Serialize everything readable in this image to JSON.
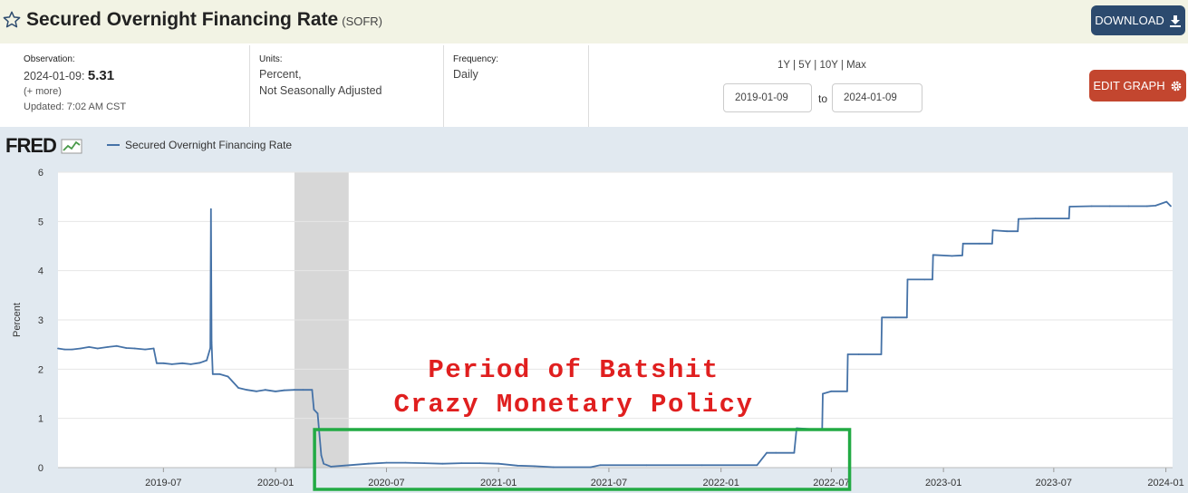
{
  "header": {
    "title": "Secured Overnight Financing Rate",
    "series_code": "(SOFR)",
    "download_label": "DOWNLOAD",
    "edit_label": "EDIT GRAPH"
  },
  "meta": {
    "observation_label": "Observation:",
    "observation_date": "2024-01-09:",
    "observation_value": "5.31",
    "more": "(+ more)",
    "updated": "Updated: 7:02 AM CST",
    "units_label": "Units:",
    "units_line1": "Percent,",
    "units_line2": "Not Seasonally Adjusted",
    "frequency_label": "Frequency:",
    "frequency_value": "Daily"
  },
  "range": {
    "quick": "1Y | 5Y | 10Y | Max",
    "start": "2019-01-09",
    "to": "to",
    "end": "2024-01-09"
  },
  "brand": {
    "logo_text": "FRED"
  },
  "colors": {
    "series": "#4572a7",
    "recession": "#d7d7d7",
    "annotation_text": "#e01f1f",
    "annotation_box": "#22aa44"
  },
  "chart_data": {
    "type": "line",
    "ylabel": "Percent",
    "ylim": [
      0,
      6
    ],
    "yticks": [
      0,
      1,
      2,
      3,
      4,
      5,
      6
    ],
    "xlim": [
      "2019-01-09",
      "2024-01-12"
    ],
    "xticks": [
      "2019-07",
      "2020-01",
      "2020-07",
      "2021-01",
      "2021-07",
      "2022-01",
      "2022-07",
      "2023-01",
      "2023-07",
      "2024-01"
    ],
    "legend": "Secured Overnight Financing Rate",
    "recession_shading": [
      "2020-02-01",
      "2020-04-30"
    ],
    "annotation": {
      "lines": [
        "Period of Batshit",
        "Crazy Monetary Policy"
      ],
      "box": [
        "2020-03-05",
        "2022-07-31"
      ]
    },
    "series": [
      {
        "name": "Secured Overnight Financing Rate",
        "x": [
          "2019-01-09",
          "2019-01-20",
          "2019-02-01",
          "2019-02-15",
          "2019-03-01",
          "2019-03-15",
          "2019-04-01",
          "2019-04-15",
          "2019-05-01",
          "2019-05-15",
          "2019-06-01",
          "2019-06-15",
          "2019-06-20",
          "2019-07-01",
          "2019-07-15",
          "2019-08-01",
          "2019-08-15",
          "2019-08-30",
          "2019-09-10",
          "2019-09-16",
          "2019-09-17",
          "2019-09-18",
          "2019-09-20",
          "2019-10-01",
          "2019-10-15",
          "2019-11-01",
          "2019-11-15",
          "2019-12-01",
          "2019-12-15",
          "2019-12-31",
          "2020-01-02",
          "2020-01-15",
          "2020-02-01",
          "2020-02-15",
          "2020-03-01",
          "2020-03-04",
          "2020-03-10",
          "2020-03-16",
          "2020-03-20",
          "2020-04-01",
          "2020-05-01",
          "2020-06-01",
          "2020-07-01",
          "2020-08-01",
          "2020-09-01",
          "2020-10-01",
          "2020-11-01",
          "2020-12-01",
          "2021-01-01",
          "2021-02-01",
          "2021-03-01",
          "2021-04-01",
          "2021-06-01",
          "2021-06-17",
          "2021-09-01",
          "2021-12-01",
          "2022-03-01",
          "2022-03-17",
          "2022-04-01",
          "2022-05-01",
          "2022-05-05",
          "2022-06-01",
          "2022-06-16",
          "2022-06-17",
          "2022-07-01",
          "2022-07-27",
          "2022-07-28",
          "2022-08-15",
          "2022-09-21",
          "2022-09-22",
          "2022-10-15",
          "2022-11-02",
          "2022-11-03",
          "2022-12-01",
          "2022-12-14",
          "2022-12-15",
          "2023-01-15",
          "2023-02-01",
          "2023-02-02",
          "2023-03-01",
          "2023-03-22",
          "2023-03-23",
          "2023-04-15",
          "2023-05-03",
          "2023-05-04",
          "2023-06-01",
          "2023-07-26",
          "2023-07-27",
          "2023-09-01",
          "2023-10-01",
          "2023-11-01",
          "2023-12-01",
          "2023-12-15",
          "2024-01-02",
          "2024-01-09"
        ],
        "values": [
          2.42,
          2.4,
          2.4,
          2.42,
          2.45,
          2.42,
          2.45,
          2.47,
          2.43,
          2.42,
          2.4,
          2.42,
          2.12,
          2.12,
          2.1,
          2.12,
          2.1,
          2.13,
          2.18,
          2.43,
          5.25,
          2.55,
          1.9,
          1.9,
          1.85,
          1.62,
          1.58,
          1.55,
          1.58,
          1.55,
          1.55,
          1.57,
          1.58,
          1.58,
          1.58,
          1.18,
          1.1,
          0.25,
          0.08,
          0.02,
          0.05,
          0.08,
          0.1,
          0.1,
          0.09,
          0.08,
          0.09,
          0.09,
          0.08,
          0.04,
          0.03,
          0.01,
          0.01,
          0.05,
          0.05,
          0.05,
          0.05,
          0.3,
          0.3,
          0.3,
          0.8,
          0.78,
          0.78,
          1.5,
          1.55,
          1.55,
          2.3,
          2.3,
          2.3,
          3.05,
          3.05,
          3.05,
          3.82,
          3.82,
          3.82,
          4.32,
          4.3,
          4.31,
          4.55,
          4.55,
          4.55,
          4.82,
          4.8,
          4.8,
          5.05,
          5.06,
          5.06,
          5.3,
          5.31,
          5.31,
          5.31,
          5.31,
          5.32,
          5.4,
          5.31
        ]
      }
    ]
  }
}
